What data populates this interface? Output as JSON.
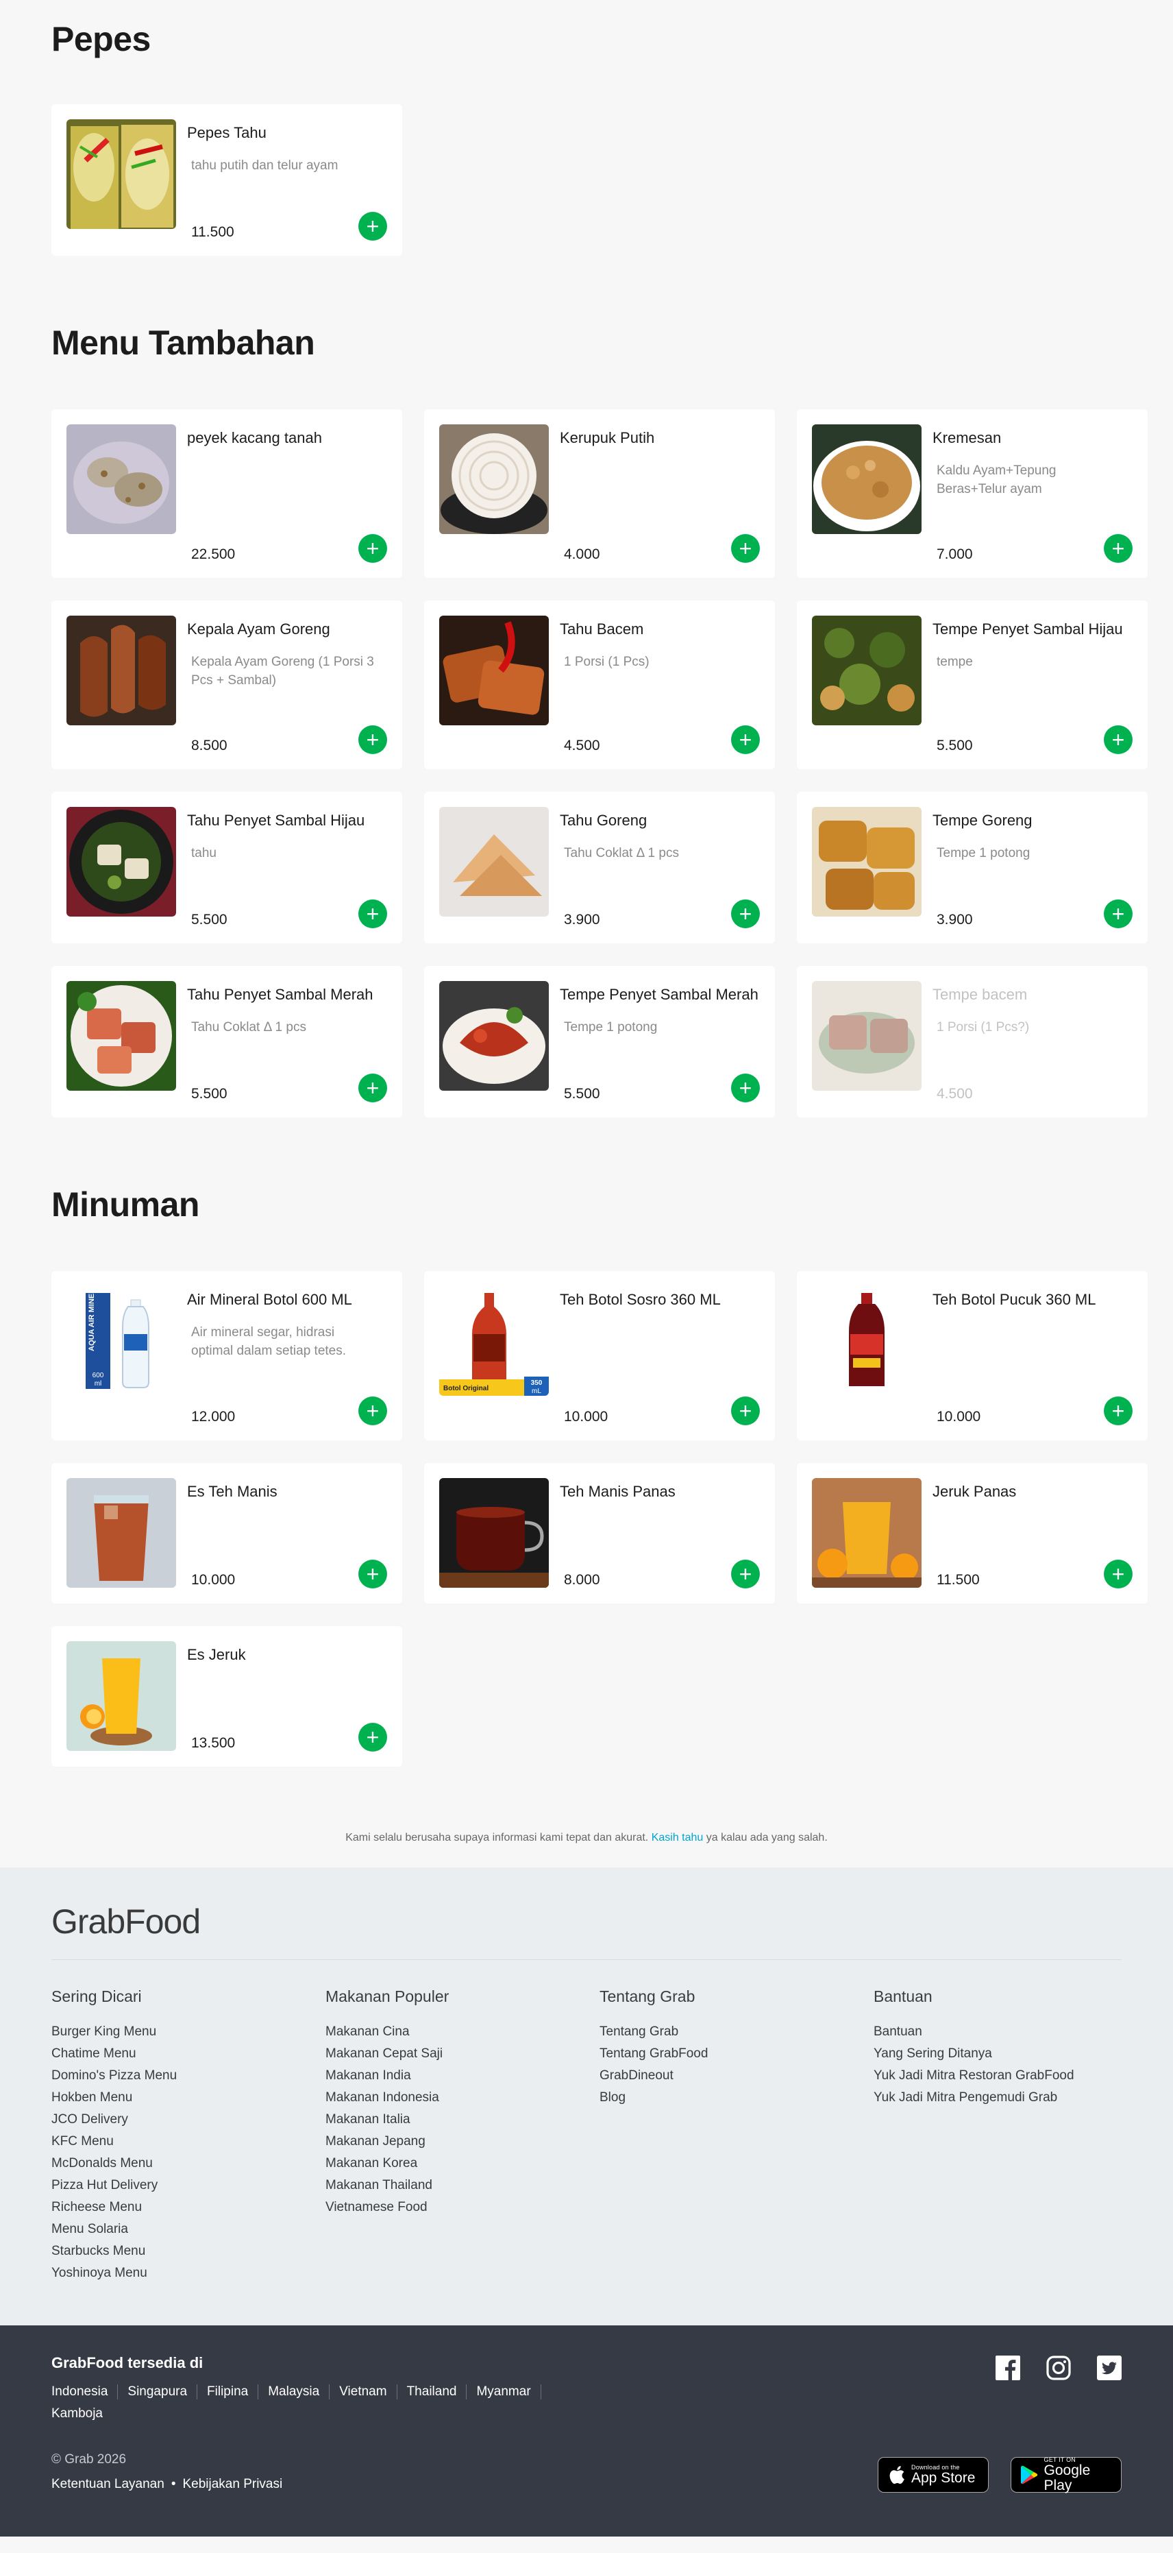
{
  "sections": [
    {
      "title": "Pepes",
      "items": [
        {
          "name": "Pepes Tahu",
          "desc": "tahu putih dan telur ayam",
          "price": "11.500",
          "img": "pepes"
        }
      ]
    },
    {
      "title": "Menu Tambahan",
      "items": [
        {
          "name": "peyek kacang tanah",
          "desc": "",
          "price": "22.500",
          "img": "peyek"
        },
        {
          "name": "Kerupuk Putih",
          "desc": "",
          "price": "4.000",
          "img": "kerupuk"
        },
        {
          "name": "Kremesan",
          "desc": "Kaldu Ayam+Tepung Beras+Telur ayam",
          "price": "7.000",
          "img": "kremesan"
        },
        {
          "name": "Kepala Ayam Goreng",
          "desc": "Kepala Ayam Goreng (1 Porsi 3 Pcs + Sambal)",
          "price": "8.500",
          "img": "kepala"
        },
        {
          "name": "Tahu Bacem",
          "desc": "1 Porsi (1 Pcs)",
          "price": "4.500",
          "img": "tahubacem"
        },
        {
          "name": "Tempe Penyet Sambal Hijau",
          "desc": "tempe",
          "price": "5.500",
          "img": "tempehijau"
        },
        {
          "name": "Tahu Penyet Sambal Hijau",
          "desc": "tahu",
          "price": "5.500",
          "img": "tahuhijau"
        },
        {
          "name": "Tahu Goreng",
          "desc": "Tahu Coklat Δ 1 pcs",
          "price": "3.900",
          "img": "tahugoreng"
        },
        {
          "name": "Tempe Goreng",
          "desc": "Tempe 1 potong",
          "price": "3.900",
          "img": "tempegoreng"
        },
        {
          "name": "Tahu Penyet Sambal Merah",
          "desc": "Tahu Coklat Δ 1 pcs",
          "price": "5.500",
          "img": "tahumerah"
        },
        {
          "name": "Tempe Penyet Sambal Merah",
          "desc": "Tempe 1 potong",
          "price": "5.500",
          "img": "tempemerah"
        },
        {
          "name": "Tempe bacem",
          "desc": "1 Porsi (1 Pcs?)",
          "price": "4.500",
          "img": "tempebacem",
          "disabled": true
        }
      ]
    },
    {
      "title": "Minuman",
      "items": [
        {
          "name": "Air Mineral Botol 600 ML",
          "desc": "Air mineral segar, hidrasi optimal dalam setiap tetes.",
          "price": "12.000",
          "img": "aqua",
          "badge": "AQUA AIR MINERAL",
          "badge2": "600 ml"
        },
        {
          "name": "Teh Botol Sosro 360 ML",
          "desc": "",
          "price": "10.000",
          "img": "sosro",
          "badge": "Botol Original",
          "badge2": "350 mL"
        },
        {
          "name": "Teh Botol Pucuk 360 ML",
          "desc": "",
          "price": "10.000",
          "img": "pucuk"
        },
        {
          "name": "Es Teh Manis",
          "desc": "",
          "price": "10.000",
          "img": "esteh"
        },
        {
          "name": "Teh Manis Panas",
          "desc": "",
          "price": "8.000",
          "img": "tehpanas"
        },
        {
          "name": "Jeruk Panas",
          "desc": "",
          "price": "11.500",
          "img": "jerukpanas"
        },
        {
          "name": "Es Jeruk",
          "desc": "",
          "price": "13.500",
          "img": "esjeruk"
        }
      ]
    }
  ],
  "add_label": "+",
  "note": {
    "text": "Kami selalu berusaha supaya informasi kami tepat dan akurat.",
    "link": "Kasih tahu",
    "suffix": "ya kalau ada yang salah."
  },
  "footer": {
    "logo": "GrabFood",
    "columns": [
      {
        "title": "Sering Dicari",
        "links": [
          "Burger King Menu",
          "Chatime Menu",
          "Domino's Pizza Menu",
          "Hokben Menu",
          "JCO Delivery",
          "KFC Menu",
          "McDonalds Menu",
          "Pizza Hut Delivery",
          "Richeese Menu",
          "Menu Solaria",
          "Starbucks Menu",
          "Yoshinoya Menu"
        ]
      },
      {
        "title": "Makanan Populer",
        "links": [
          "Makanan Cina",
          "Makanan Cepat Saji",
          "Makanan India",
          "Makanan Indonesia",
          "Makanan Italia",
          "Makanan Jepang",
          "Makanan Korea",
          "Makanan Thailand",
          "Vietnamese Food"
        ]
      },
      {
        "title": "Tentang Grab",
        "links": [
          "Tentang Grab",
          "Tentang GrabFood",
          "GrabDineout",
          "Blog"
        ]
      },
      {
        "title": "Bantuan",
        "links": [
          "Bantuan",
          "Yang Sering Ditanya",
          "Yuk Jadi Mitra Restoran GrabFood",
          "Yuk Jadi Mitra Pengemudi Grab"
        ]
      }
    ],
    "available_title": "GrabFood tersedia di",
    "countries": [
      "Indonesia",
      "Singapura",
      "Filipina",
      "Malaysia",
      "Vietnam",
      "Thailand",
      "Myanmar",
      "Kamboja"
    ],
    "copyright": "© Grab 2026",
    "terms": "Ketentuan Layanan",
    "privacy": "Kebijakan Privasi",
    "separator": "•",
    "social": [
      "facebook-icon",
      "instagram-icon",
      "twitter-icon"
    ],
    "appstore": {
      "small": "Download on the",
      "big": "App Store"
    },
    "googleplay": {
      "small": "GET IT ON",
      "big": "Google Play"
    },
    "colors": {
      "accent": "#00b14f",
      "link": "#00a5cf",
      "footer_dark": "#363a45",
      "footer_light": "#eaeef1"
    }
  }
}
